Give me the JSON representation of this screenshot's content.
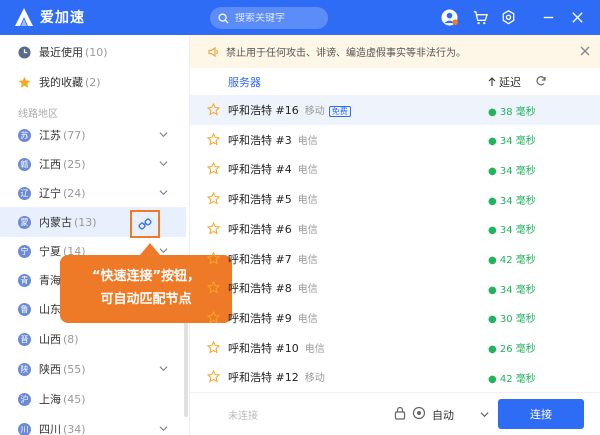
{
  "app": {
    "name": "爱加速"
  },
  "search": {
    "placeholder": "搜索关键字"
  },
  "sidebar": {
    "top_items": [
      {
        "label": "最近使用",
        "count": "(10)"
      },
      {
        "label": "我的收藏",
        "count": "(2)"
      }
    ],
    "section_label": "线路地区",
    "regions": [
      {
        "icon_char": "苏",
        "label": "江苏",
        "count": "(77)"
      },
      {
        "icon_char": "赣",
        "label": "江西",
        "count": "(25)"
      },
      {
        "icon_char": "辽",
        "label": "辽宁",
        "count": "(24)"
      },
      {
        "icon_char": "蒙",
        "label": "内蒙古",
        "count": "(13)"
      },
      {
        "icon_char": "宁",
        "label": "宁夏",
        "count": "(14)"
      },
      {
        "icon_char": "青",
        "label": "青海",
        "count": ""
      },
      {
        "icon_char": "鲁",
        "label": "山东",
        "count": ""
      },
      {
        "icon_char": "晋",
        "label": "山西",
        "count": "(8)"
      },
      {
        "icon_char": "陕",
        "label": "陕西",
        "count": "(55)"
      },
      {
        "icon_char": "沪",
        "label": "上海",
        "count": "(45)"
      },
      {
        "icon_char": "川",
        "label": "四川",
        "count": "(34)"
      }
    ]
  },
  "callout": {
    "line1": "“快速连接”按钮，",
    "line2": "可自动匹配节点"
  },
  "notice": {
    "text": "禁止用于任何攻击、诽谤、编造虚假事实等非法行为。"
  },
  "table": {
    "col_server": "服务器",
    "col_latency": "延迟",
    "rows": [
      {
        "name": "呼和浩特 #16",
        "carrier": "移动",
        "badge": "免费",
        "latency": "● 38 毫秒"
      },
      {
        "name": "呼和浩特 #3",
        "carrier": "电信",
        "badge": "",
        "latency": "● 34 毫秒"
      },
      {
        "name": "呼和浩特 #4",
        "carrier": "电信",
        "badge": "",
        "latency": "● 34 毫秒"
      },
      {
        "name": "呼和浩特 #5",
        "carrier": "电信",
        "badge": "",
        "latency": "● 34 毫秒"
      },
      {
        "name": "呼和浩特 #6",
        "carrier": "电信",
        "badge": "",
        "latency": "● 34 毫秒"
      },
      {
        "name": "呼和浩特 #7",
        "carrier": "电信",
        "badge": "",
        "latency": "● 42 毫秒"
      },
      {
        "name": "呼和浩特 #8",
        "carrier": "电信",
        "badge": "",
        "latency": "● 34 毫秒"
      },
      {
        "name": "呼和浩特 #9",
        "carrier": "电信",
        "badge": "",
        "latency": "● 30 毫秒"
      },
      {
        "name": "呼和浩特 #10",
        "carrier": "电信",
        "badge": "",
        "latency": "● 26 毫秒"
      },
      {
        "name": "呼和浩特 #12",
        "carrier": "移动",
        "badge": "",
        "latency": "● 42 毫秒"
      }
    ]
  },
  "footer": {
    "status": "未连接",
    "mode": "自动",
    "connect_label": "连接"
  },
  "colors": {
    "brand": "#2f6cf5",
    "accent": "#ee7a27",
    "latency": "#22b35e"
  }
}
